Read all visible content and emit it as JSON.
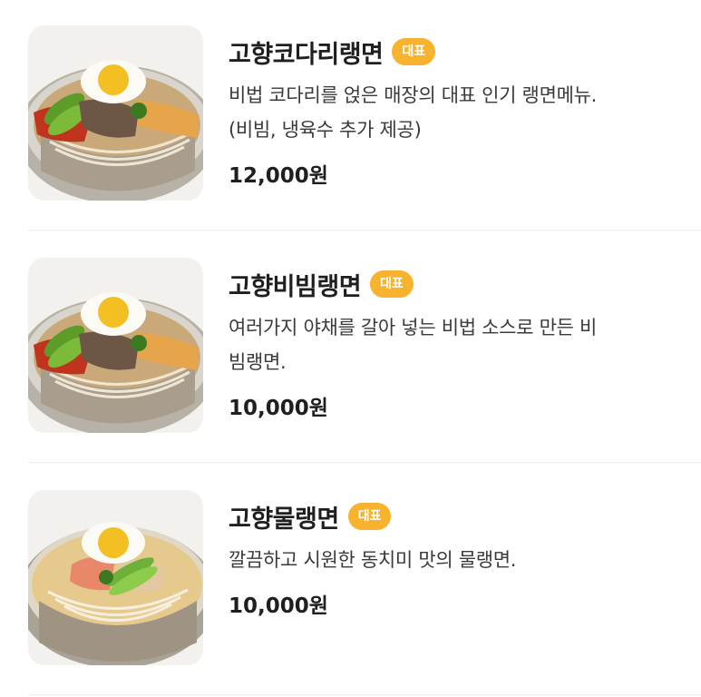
{
  "menu": {
    "items": [
      {
        "name": "고향코다리랭면",
        "badge": "대표",
        "desc_lines": [
          "비법 코다리를 얹은 매장의 대표 인기 랭면메뉴.",
          "(비빔, 냉육수 추가 제공)"
        ],
        "price": "12,000원",
        "image_icon": "bibim-naengmyeon-photo"
      },
      {
        "name": "고향비빔랭면",
        "badge": "대표",
        "desc_lines": [
          "여러가지 야채를 갈아 넣는 비법 소스로 만든 비",
          "빔랭면."
        ],
        "price": "10,000원",
        "image_icon": "bibim-naengmyeon-photo"
      },
      {
        "name": "고향물랭면",
        "badge": "대표",
        "desc_lines": [
          "깔끔하고 시원한 동치미 맛의 물랭면."
        ],
        "price": "10,000원",
        "image_icon": "mul-naengmyeon-photo"
      }
    ]
  },
  "colors": {
    "badge": "#f7b22e",
    "text": "#1f1f1f",
    "divider": "#ececec"
  }
}
